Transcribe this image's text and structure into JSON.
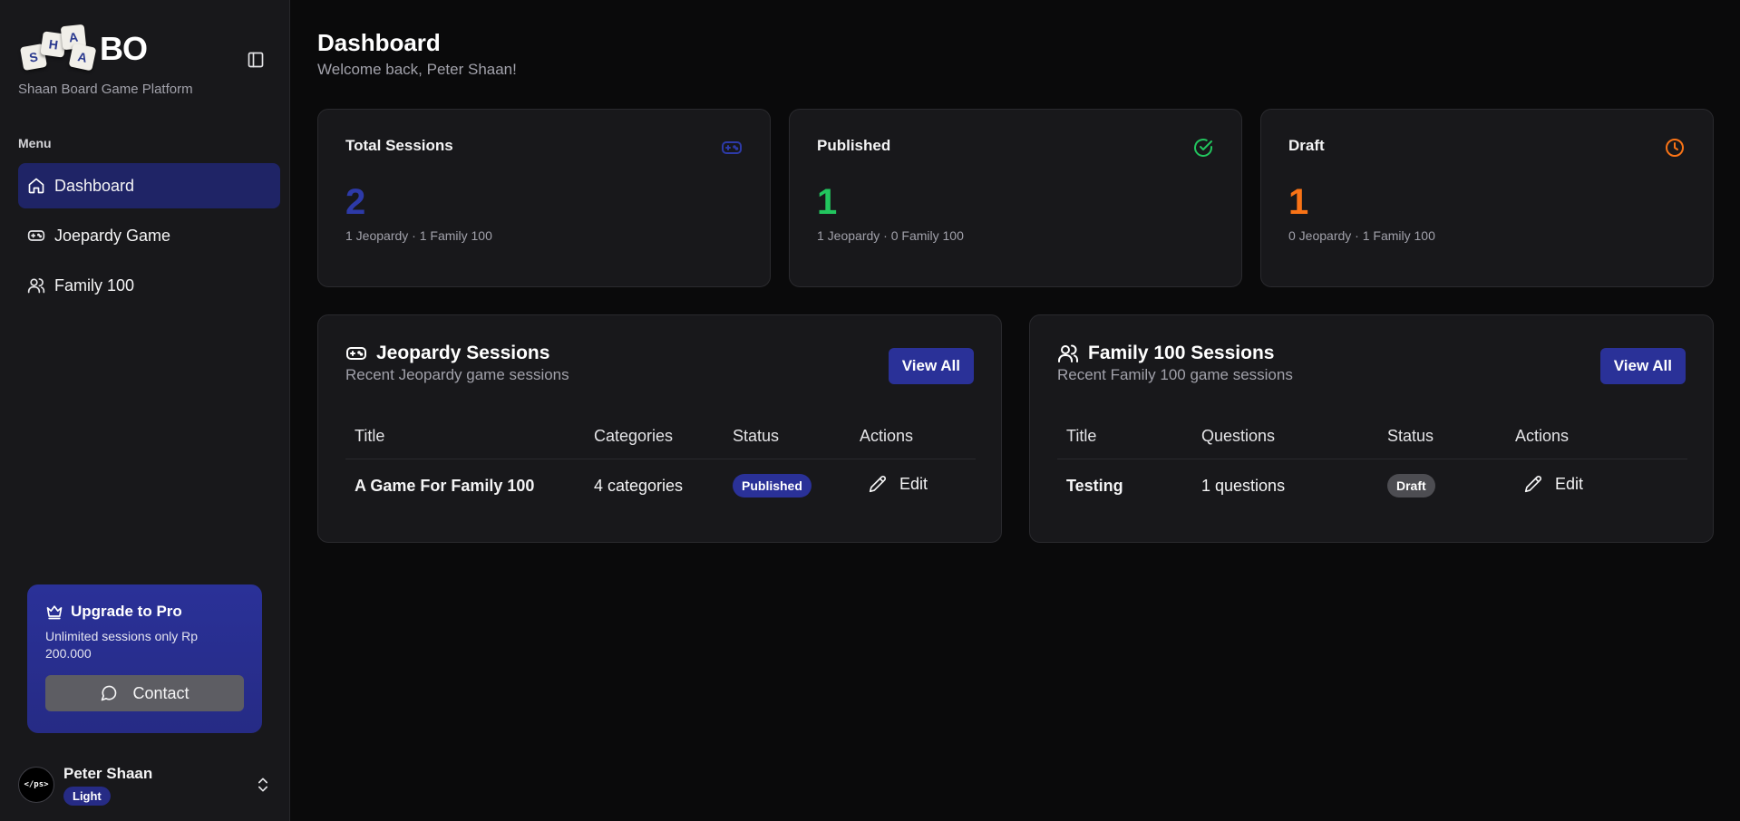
{
  "brand": {
    "tiles": [
      "S",
      "H",
      "A",
      "A"
    ],
    "name": "BO",
    "tagline": "Shaan Board Game Platform"
  },
  "sidebar": {
    "menu_label": "Menu",
    "items": [
      {
        "label": "Dashboard",
        "icon": "home-icon",
        "active": true
      },
      {
        "label": "Joepardy Game",
        "icon": "gamepad-icon",
        "active": false
      },
      {
        "label": "Family 100",
        "icon": "users-icon",
        "active": false
      }
    ],
    "upgrade": {
      "title": "Upgrade to Pro",
      "description": "Unlimited sessions only Rp 200.000",
      "button": "Contact"
    },
    "user": {
      "avatar_text": "</ps>",
      "name": "Peter Shaan",
      "badge": "Light"
    }
  },
  "header": {
    "title": "Dashboard",
    "subtitle": "Welcome back, Peter Shaan!"
  },
  "stats": [
    {
      "label": "Total Sessions",
      "value": "2",
      "meta": "1 Jeopardy · 1 Family 100",
      "color": "#2d3aa8",
      "icon": "gamepad-icon"
    },
    {
      "label": "Published",
      "value": "1",
      "meta": "1 Jeopardy · 0 Family 100",
      "color": "#22c55e",
      "icon": "check-circle-icon"
    },
    {
      "label": "Draft",
      "value": "1",
      "meta": "0 Jeopardy · 1 Family 100",
      "color": "#f97316",
      "icon": "clock-icon"
    }
  ],
  "jeopardy": {
    "title": "Jeopardy Sessions",
    "subtitle": "Recent Jeopardy game sessions",
    "view_all": "View All",
    "columns": [
      "Title",
      "Categories",
      "Status",
      "Actions"
    ],
    "rows": [
      {
        "title": "A Game For Family 100",
        "count": "4 categories",
        "status": "Published",
        "action": "Edit"
      }
    ]
  },
  "family": {
    "title": "Family 100 Sessions",
    "subtitle": "Recent Family 100 game sessions",
    "view_all": "View All",
    "columns": [
      "Title",
      "Questions",
      "Status",
      "Actions"
    ],
    "rows": [
      {
        "title": "Testing",
        "count": "1 questions",
        "status": "Draft",
        "action": "Edit"
      }
    ]
  },
  "colors": {
    "accent": "#2a3198",
    "sidebar_active": "#1f2466",
    "background": "#0a0a0b",
    "card": "#18181b"
  }
}
